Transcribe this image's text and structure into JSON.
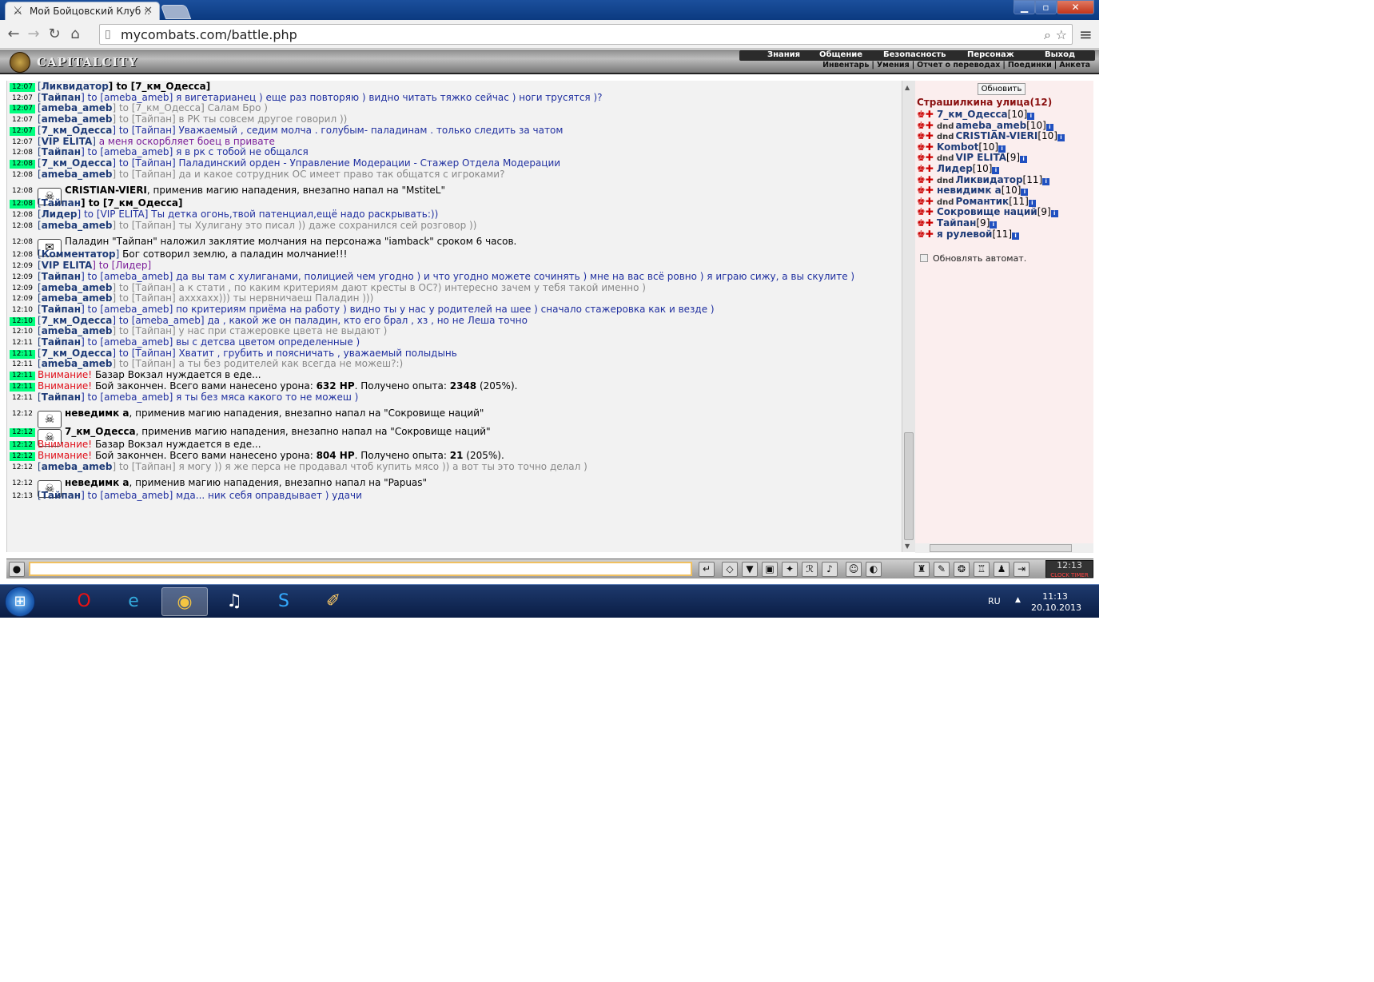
{
  "browser": {
    "tab_title": "Мой Бойцовский Клуб ::",
    "url": "mycombats.com/battle.php"
  },
  "game": {
    "logo": "CAPITALCITY",
    "menu": [
      "Знания",
      "Общение",
      "Безопасность",
      "Персонаж",
      "Выход"
    ],
    "submenu": [
      "Инвентарь",
      "Умения",
      "Отчет о переводах",
      "Поединки",
      "Анкета"
    ]
  },
  "chat": {
    "lines": [
      {
        "t": "12:07",
        "h": true,
        "type": "to",
        "from": "Ликвидатор",
        "to": "7_км_Одесса",
        "text": "",
        "bold": true,
        "style": "black"
      },
      {
        "t": "12:07",
        "h": false,
        "type": "to",
        "from": "Тайпан",
        "to": "ameba_ameb",
        "text": "я вигетарианец ) еще раз повторяю ) видно читать тяжко сейчас ) ноги трусятся )?",
        "style": "blue"
      },
      {
        "t": "12:07",
        "h": true,
        "type": "to",
        "from": "ameba_ameb",
        "to": "7_км_Одесса",
        "text": "Салам Бро )",
        "style": "gray"
      },
      {
        "t": "12:07",
        "h": false,
        "type": "to",
        "from": "ameba_ameb",
        "to": "Тайпан",
        "text": "в РК ты совсем другое говорил ))",
        "style": "gray"
      },
      {
        "t": "12:07",
        "h": true,
        "type": "to",
        "from": "7_км_Одесса",
        "to": "Тайпан",
        "text": "Уважаемый , седим молча . голубым- паладинам . только следить за чатом",
        "style": "blue"
      },
      {
        "t": "12:07",
        "h": false,
        "type": "plain",
        "from": "VIP ELITA",
        "text": "а меня оскорбляет боец в привате",
        "style": "purple"
      },
      {
        "t": "12:08",
        "h": false,
        "type": "to",
        "from": "Тайпан",
        "to": "ameba_ameb",
        "text": "я в рк с тобой не общался",
        "style": "blue"
      },
      {
        "t": "12:08",
        "h": true,
        "type": "to",
        "from": "7_км_Одесса",
        "to": "Тайпан",
        "text": "Паладинский орден - Управление Модерации - Стажер Отдела Модерации",
        "style": "blue"
      },
      {
        "t": "12:08",
        "h": false,
        "type": "to",
        "from": "ameba_ameb",
        "to": "Тайпан",
        "text": "да и какое сотрудник ОС имеет право так общатся с игроками?",
        "style": "gray"
      },
      {
        "t": "12:08",
        "h": false,
        "type": "sys",
        "icon": "☠",
        "actor": "CRISTIAN-VIERI",
        "text": ", применив магию нападения, внезапно напал на \"MstiteL\""
      },
      {
        "t": "12:08",
        "h": true,
        "type": "to",
        "from": "Тайпан",
        "to": "7_км_Одесса",
        "text": "",
        "bold": true,
        "style": "black"
      },
      {
        "t": "12:08",
        "h": false,
        "type": "to",
        "from": "Лидер",
        "to": "VIP ELITA",
        "text": "Ты детка огонь,твой патенциал,ещё надо раскрывать:))",
        "style": "blue"
      },
      {
        "t": "12:08",
        "h": false,
        "type": "to",
        "from": "ameba_ameb",
        "to": "Тайпан",
        "text": "ты Хулигану это писал )) даже сохранился сей розговор ))",
        "style": "gray"
      },
      {
        "t": "12:08",
        "h": false,
        "type": "sys",
        "icon": "✉",
        "actor": "",
        "text": "Паладин \"Тайпан\" наложил заклятие молчания на персонажа \"iamback\" сроком 6 часов."
      },
      {
        "t": "12:08",
        "h": false,
        "type": "plain",
        "from": "Комментатор",
        "text": "Бог сотворил землю, а паладин молчание!!!",
        "style": "black"
      },
      {
        "t": "12:09",
        "h": false,
        "type": "to",
        "from": "VIP ELITA",
        "to": "Лидер",
        "text": "",
        "style": "purple"
      },
      {
        "t": "12:09",
        "h": false,
        "type": "to",
        "from": "Тайпан",
        "to": "ameba_ameb",
        "text": "да вы там с хулиганами, полицией чем угодно ) и что угодно можете сочинять ) мне на вас всё ровно ) я играю сижу, а вы скулите )",
        "style": "blue"
      },
      {
        "t": "12:09",
        "h": false,
        "type": "to",
        "from": "ameba_ameb",
        "to": "Тайпан",
        "text": "а к стати , по каким критериям дают кресты в ОС?) интересно зачем у тебя такой именно )",
        "style": "gray"
      },
      {
        "t": "12:09",
        "h": false,
        "type": "to",
        "from": "ameba_ameb",
        "to": "Тайпан",
        "text": "ахххахх))) ты нервничаеш Паладин )))",
        "style": "gray"
      },
      {
        "t": "12:10",
        "h": false,
        "type": "to",
        "from": "Тайпан",
        "to": "ameba_ameb",
        "text": "по критериям приёма на работу ) видно ты у нас у родителей на шее ) сначало стажеровка как и везде )",
        "style": "blue"
      },
      {
        "t": "12:10",
        "h": true,
        "type": "to",
        "from": "7_км_Одесса",
        "to": "ameba_ameb",
        "text": "да , какой же он паладин, кто его брал , хз , но не Леша точно",
        "style": "blue"
      },
      {
        "t": "12:10",
        "h": false,
        "type": "to",
        "from": "ameba_ameb",
        "to": "Тайпан",
        "text": "у нас при стажеровке цвета не выдают )",
        "style": "gray"
      },
      {
        "t": "12:11",
        "h": false,
        "type": "to",
        "from": "Тайпан",
        "to": "ameba_ameb",
        "text": "вы с детсва цветом определенные )",
        "style": "blue"
      },
      {
        "t": "12:11",
        "h": true,
        "type": "to",
        "from": "7_км_Одесса",
        "to": "Тайпан",
        "text": "Хватит , грубить и поясничать , уважаемый полыдынь",
        "style": "blue"
      },
      {
        "t": "12:11",
        "h": false,
        "type": "to",
        "from": "ameba_ameb",
        "to": "Тайпан",
        "text": "а ты без родителей как всегда не можеш?:)",
        "style": "gray"
      },
      {
        "t": "12:11",
        "h": true,
        "type": "warn",
        "label": "Внимание!",
        "text": "Базар Вокзал нуждается в еде..."
      },
      {
        "t": "12:11",
        "h": true,
        "type": "warn",
        "label": "Внимание!",
        "text": "Бой закончен. Всего вами нанесено урона: ",
        "hp": "632 HP",
        "mid": ". Получено опыта: ",
        "exp": "2348",
        "end": " (205%)."
      },
      {
        "t": "12:11",
        "h": false,
        "type": "to",
        "from": "Тайпан",
        "to": "ameba_ameb",
        "text": "я ты без мяса какого то не можеш )",
        "style": "blue"
      },
      {
        "t": "12:12",
        "h": false,
        "type": "sys",
        "icon": "☠",
        "actor": "неведимк а",
        "text": ", применив магию нападения, внезапно напал на \"Сокровище наций\""
      },
      {
        "t": "12:12",
        "h": true,
        "type": "sys",
        "icon": "☠",
        "actor": "7_км_Одесса",
        "text": ", применив магию нападения, внезапно напал на \"Сокровище наций\""
      },
      {
        "t": "12:12",
        "h": true,
        "type": "warn",
        "label": "Внимание!",
        "text": "Базар Вокзал нуждается в еде..."
      },
      {
        "t": "12:12",
        "h": true,
        "type": "warn",
        "label": "Внимание!",
        "text": "Бой закончен. Всего вами нанесено урона: ",
        "hp": "804 HP",
        "mid": ". Получено опыта: ",
        "exp": "21",
        "end": " (205%)."
      },
      {
        "t": "12:12",
        "h": false,
        "type": "to",
        "from": "ameba_ameb",
        "to": "Тайпан",
        "text": "я могу )) я же перса не продавал чтоб купить мясо )) а вот ты это точно делал )",
        "style": "gray"
      },
      {
        "t": "12:12",
        "h": false,
        "type": "sys",
        "icon": "☠",
        "actor": "неведимк а",
        "text": ", применив магию нападения, внезапно напал на \"Papuas\""
      },
      {
        "t": "12:13",
        "h": false,
        "type": "to",
        "from": "Тайпан",
        "to": "ameba_ameb",
        "text": "мда... ник себя оправдывает ) удачи",
        "style": "blue"
      }
    ]
  },
  "sidebar": {
    "refresh_label": "Обновить",
    "room": "Страшилкина улица(12)",
    "auto_refresh_label": "Обновлять автомат.",
    "players": [
      {
        "name": "7_км_Одесса",
        "level": "[10]",
        "dnd": false
      },
      {
        "name": "ameba_ameb",
        "level": "[10]",
        "dnd": true
      },
      {
        "name": "CRISTIAN-VIERI",
        "level": "[10]",
        "dnd": true
      },
      {
        "name": "Kombot",
        "level": "[10]",
        "dnd": false
      },
      {
        "name": "VIP ELITA",
        "level": "[9]",
        "dnd": true
      },
      {
        "name": "Лидер",
        "level": "[10]",
        "dnd": false
      },
      {
        "name": "Ликвидатор",
        "level": "[11]",
        "dnd": true
      },
      {
        "name": "невидимк а",
        "level": "[10]",
        "dnd": false
      },
      {
        "name": "Романтик",
        "level": "[11]",
        "dnd": true
      },
      {
        "name": "Сокровище наций",
        "level": "[9]",
        "dnd": false
      },
      {
        "name": "Тайпан",
        "level": "[9]",
        "dnd": false
      },
      {
        "name": "я рулевой",
        "level": "[11]",
        "dnd": false
      }
    ],
    "info_icon": "i"
  },
  "bottombar": {
    "clock_time": "12:13",
    "clock_label": "CLOCK TIMER"
  },
  "taskbar": {
    "lang": "RU",
    "time": "11:13",
    "date": "20.10.2013"
  },
  "colors": {
    "highlight_time": "#00ff7f",
    "nick": "#1f3c78",
    "private": "#2030a0",
    "gray": "#888888",
    "warning": "#e0101a",
    "room": "#8a1010"
  }
}
